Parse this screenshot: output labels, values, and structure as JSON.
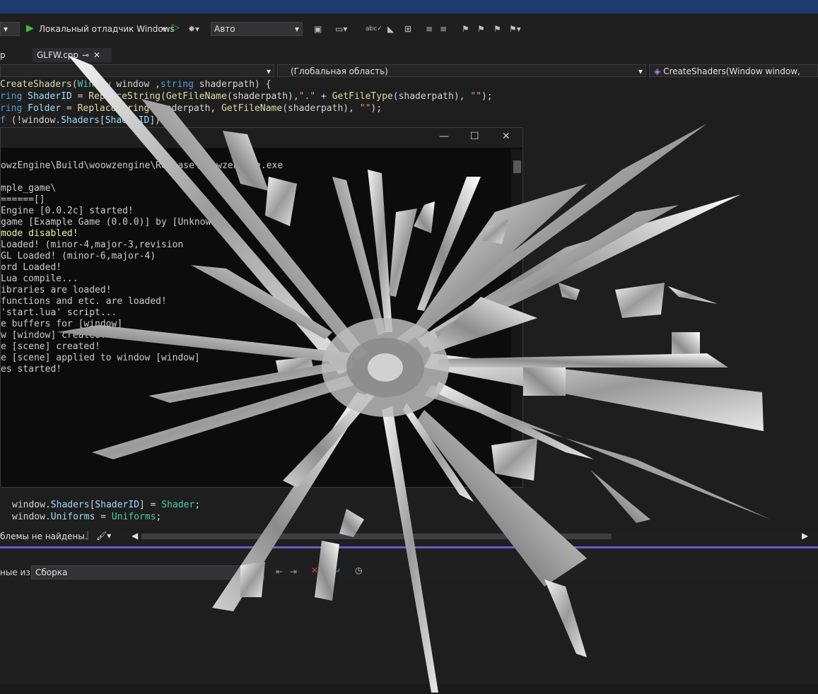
{
  "toolbar": {
    "run_label": "Локальный отладчик Windows",
    "config_value": "Авто"
  },
  "tabs": [
    {
      "label": "GLFW.cpp"
    }
  ],
  "navbar": {
    "scope": "(Глобальная область)",
    "member": "CreateShaders(Window window, string sh"
  },
  "code_top": [
    "CreateShaders(Window window ,string shaderpath) {",
    "ring ShaderID = ReplaceString(GetFileName(shaderpath),\".\" + GetFileType(shaderpath), \"\");",
    "ring Folder = ReplaceString(shaderpath, GetFileName(shaderpath), \"\");",
    "f (!window.Shaders[ShaderID])"
  ],
  "code_bottom": [
    "window.Shaders[ShaderID] = Shader;",
    "window.Uniforms = Uniforms;"
  ],
  "console": {
    "lines": [
      "owzEngine\\Build\\woowzengine\\Release\\woowzengine.exe",
      "",
      "mple_game\\",
      "======[]",
      "Engine [0.0.2c] started!",
      "game [Example Game (0.0.0)] by [Unknown]",
      "mode disabled!",
      "Loaded! (minor-4,major-3,revision",
      "GL Loaded! (minor-6,major-4)",
      "ord Loaded!",
      "Lua compile...",
      "ibraries are loaded!",
      "functions and etc. are loaded!",
      "'start.lua' script...",
      "e buffers for [window]",
      "w [window] created!",
      "e [scene] created!",
      "e [scene] applied to window [window]",
      "es started!"
    ]
  },
  "status": {
    "problems": "блемы не найдены."
  },
  "output": {
    "show_from_label": "ные из:",
    "source_value": "Сборка"
  },
  "colors": {
    "accent": "#6f5ac7",
    "titlebar": "#1e3a6e",
    "editor_bg": "#1e1e1e",
    "console_bg": "#0c0c0c"
  }
}
